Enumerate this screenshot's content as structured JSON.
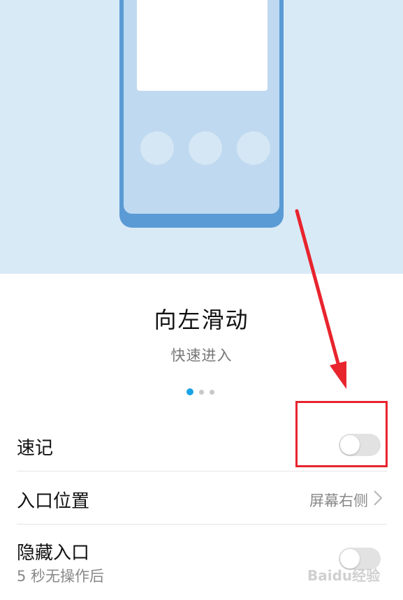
{
  "hero": {
    "title": "向左滑动",
    "subtitle": "快速进入"
  },
  "pager": {
    "total": 3,
    "active_index": 0
  },
  "settings": [
    {
      "label": "速记",
      "toggle_on": false
    },
    {
      "label": "入口位置",
      "value": "屏幕右侧"
    },
    {
      "label": "隐藏入口",
      "sublabel": "5 秒无操作后",
      "toggle_on": false
    }
  ],
  "watermark": "Baidu经验",
  "colors": {
    "hero_bg": "#d9eaf7",
    "phone_frame": "#5b9bd5",
    "pager_active": "#1aa3e8",
    "annotation_red": "#e8242d"
  }
}
